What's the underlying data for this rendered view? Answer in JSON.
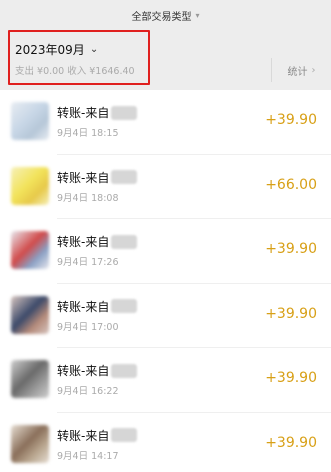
{
  "filter": {
    "label": "全部交易类型",
    "caret": "▾"
  },
  "summary": {
    "month": "2023年09月",
    "totals": "支出 ¥0.00 收入 ¥1646.40",
    "stats_label": "统计",
    "stats_arrow": "›"
  },
  "colors": {
    "accent_amount": "#d8a017",
    "highlight": "#e0201f"
  },
  "transactions": [
    {
      "title": "转账-来自",
      "time": "9月4日 18:15",
      "amount": "+39.90",
      "avatar_colors": [
        "#c7d6e6",
        "#b6c7d8",
        "#e7ecf2"
      ]
    },
    {
      "title": "转账-来自",
      "time": "9月4日 18:08",
      "amount": "+66.00",
      "avatar_colors": [
        "#f2e35a",
        "#e7c94a",
        "#f6f0b8"
      ]
    },
    {
      "title": "转账-来自",
      "time": "9月4日 17:26",
      "amount": "+39.90",
      "avatar_colors": [
        "#d14b4b",
        "#8aa0c4",
        "#e8e8ee"
      ]
    },
    {
      "title": "转账-来自",
      "time": "9月4日 17:00",
      "amount": "+39.90",
      "avatar_colors": [
        "#3c4a6a",
        "#b48a7a",
        "#d8c6c0"
      ]
    },
    {
      "title": "转账-来自",
      "time": "9月4日 16:22",
      "amount": "+39.90",
      "avatar_colors": [
        "#6a6a6a",
        "#9a9a9a",
        "#cfcfcf"
      ]
    },
    {
      "title": "转账-来自",
      "time": "9月4日 14:17",
      "amount": "+39.90",
      "avatar_colors": [
        "#8a6f5a",
        "#b9a68f",
        "#e6ddd2"
      ]
    }
  ]
}
